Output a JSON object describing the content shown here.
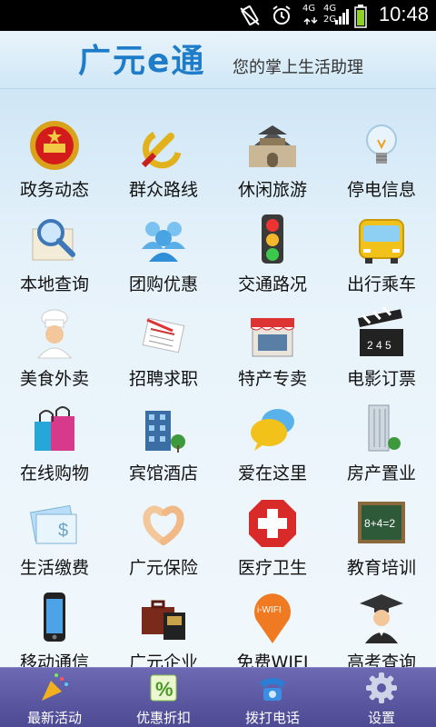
{
  "statusbar": {
    "time": "10:48",
    "network1": "4G",
    "network2": "4G",
    "network3": "2G"
  },
  "header": {
    "logo": "广元e通",
    "slogan": "您的掌上生活助理"
  },
  "grid": [
    {
      "label": "政务动态",
      "icon": "national-emblem-icon"
    },
    {
      "label": "群众路线",
      "icon": "party-emblem-icon"
    },
    {
      "label": "休闲旅游",
      "icon": "city-gate-icon"
    },
    {
      "label": "停电信息",
      "icon": "light-bulb-icon"
    },
    {
      "label": "本地查询",
      "icon": "magnifier-map-icon"
    },
    {
      "label": "团购优惠",
      "icon": "group-people-icon"
    },
    {
      "label": "交通路况",
      "icon": "traffic-light-icon"
    },
    {
      "label": "出行乘车",
      "icon": "bus-icon"
    },
    {
      "label": "美食外卖",
      "icon": "chef-icon"
    },
    {
      "label": "招聘求职",
      "icon": "resume-pen-icon"
    },
    {
      "label": "特产专卖",
      "icon": "shop-icon"
    },
    {
      "label": "电影订票",
      "icon": "clapperboard-icon"
    },
    {
      "label": "在线购物",
      "icon": "shopping-bag-icon"
    },
    {
      "label": "宾馆酒店",
      "icon": "hotel-icon"
    },
    {
      "label": "爱在这里",
      "icon": "chat-bubble-icon"
    },
    {
      "label": "房产置业",
      "icon": "building-icon"
    },
    {
      "label": "生活缴费",
      "icon": "payment-card-icon"
    },
    {
      "label": "广元保险",
      "icon": "heart-hands-icon"
    },
    {
      "label": "医疗卫生",
      "icon": "medical-cross-icon"
    },
    {
      "label": "教育培训",
      "icon": "blackboard-icon"
    },
    {
      "label": "移动通信",
      "icon": "mobile-phone-icon"
    },
    {
      "label": "广元企业",
      "icon": "briefcase-icon"
    },
    {
      "label": "免费WIFI",
      "icon": "wifi-pin-icon"
    },
    {
      "label": "高考查询",
      "icon": "graduate-icon"
    }
  ],
  "wifi_pin_text": "i-WIFI",
  "clapper_text": "2 4 5",
  "blackboard_text": "8+4=2",
  "bottomnav": [
    {
      "label": "最新活动",
      "icon": "party-horn-icon"
    },
    {
      "label": "优惠折扣",
      "icon": "discount-icon"
    },
    {
      "label": "拨打电话",
      "icon": "telephone-icon"
    },
    {
      "label": "设置",
      "icon": "gear-icon"
    }
  ],
  "discount_symbol": "%"
}
